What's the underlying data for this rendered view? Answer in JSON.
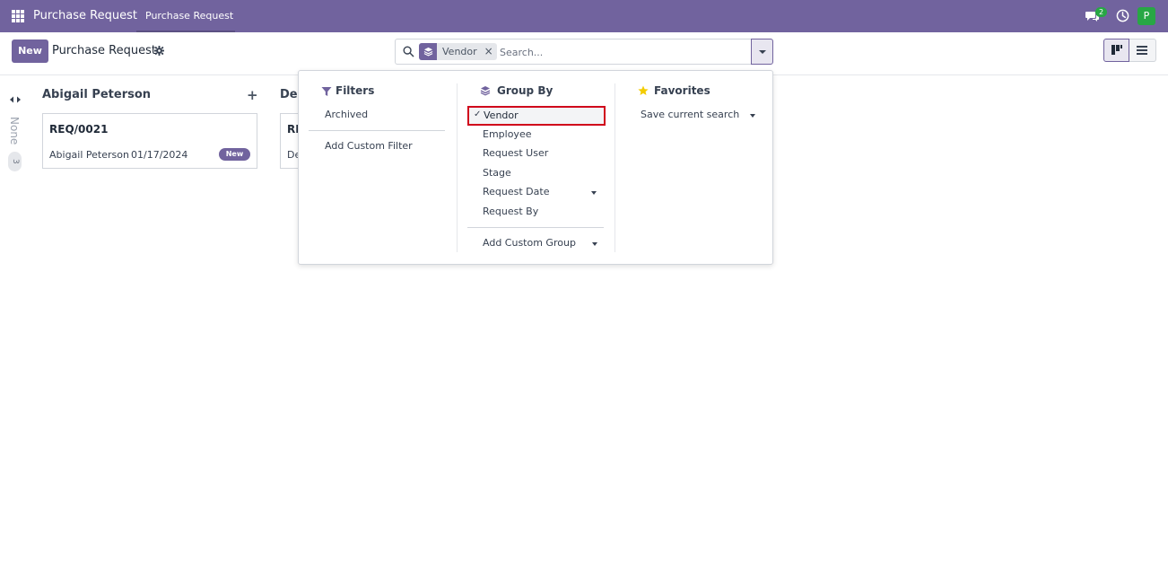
{
  "navbar": {
    "apps_icon": "apps-grid-icon",
    "brand": "Purchase Request",
    "menu_item": "Purchase Request",
    "chat_icon": "chat-bubbles-icon",
    "chat_badge": "2",
    "activity_icon": "clock-icon",
    "avatar_letter": "P",
    "avatar_color": "#28a745",
    "accent_color": "#71639e"
  },
  "control_panel": {
    "new_button": "New",
    "title": "Purchase Request",
    "settings_icon": "gear-icon",
    "search": {
      "facet_icon": "layers-icon",
      "facet_label": "Vendor",
      "facet_remove": "×",
      "placeholder": "Search...",
      "toggle_icon": "caret-down-icon"
    },
    "views": [
      {
        "name": "kanban",
        "icon": "kanban-icon",
        "active": true
      },
      {
        "name": "list",
        "icon": "list-icon",
        "active": false
      }
    ]
  },
  "kanban": {
    "fold_icon": "expand-horizontal-icon",
    "folded_column": {
      "label": "None",
      "count": "3"
    },
    "columns": [
      {
        "title": "Abigail Peterson",
        "add_icon": "plus-icon",
        "cards": [
          {
            "ref": "REQ/0021",
            "employee": "Abigail Peterson",
            "date": "01/17/2024",
            "stage": "New"
          }
        ]
      },
      {
        "title": "Dec",
        "cards": [
          {
            "ref": "RE",
            "employee": "De"
          }
        ]
      }
    ]
  },
  "search_panel": {
    "filters": {
      "title": "Filters",
      "icon": "funnel-icon",
      "items": [
        "Archived"
      ],
      "custom": "Add Custom Filter"
    },
    "group_by": {
      "title": "Group By",
      "icon": "layers-icon",
      "items": [
        {
          "label": "Vendor",
          "selected": true
        },
        {
          "label": "Employee",
          "selected": false
        },
        {
          "label": "Request User",
          "selected": false
        },
        {
          "label": "Stage",
          "selected": false
        },
        {
          "label": "Request Date",
          "selected": false,
          "has_submenu": true
        },
        {
          "label": "Request By",
          "selected": false
        }
      ],
      "custom": "Add Custom Group",
      "check_mark": "✓"
    },
    "favorites": {
      "title": "Favorites",
      "icon": "star-icon",
      "star_color": "#f3cc00",
      "save": "Save current search"
    }
  }
}
